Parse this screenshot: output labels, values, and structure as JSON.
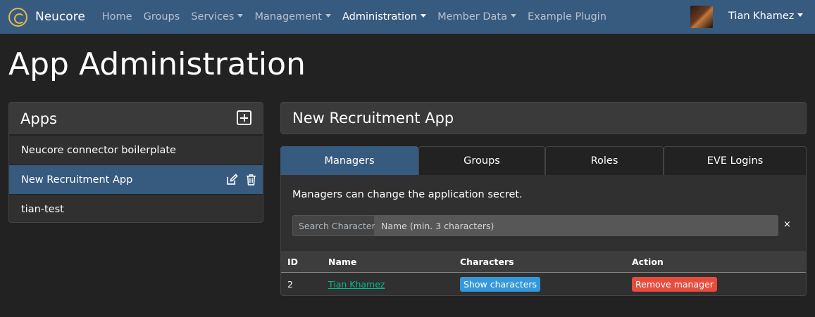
{
  "navbar": {
    "brand": "Neucore",
    "items": [
      {
        "label": "Home",
        "dropdown": false,
        "active": false
      },
      {
        "label": "Groups",
        "dropdown": false,
        "active": false
      },
      {
        "label": "Services",
        "dropdown": true,
        "active": false
      },
      {
        "label": "Management",
        "dropdown": true,
        "active": false
      },
      {
        "label": "Administration",
        "dropdown": true,
        "active": true
      },
      {
        "label": "Member Data",
        "dropdown": true,
        "active": false
      },
      {
        "label": "Example Plugin",
        "dropdown": false,
        "active": false
      }
    ],
    "user_name": "Tian Khamez"
  },
  "page": {
    "title": "App Administration"
  },
  "apps": {
    "header": "Apps",
    "items": [
      {
        "label": "Neucore connector boilerplate",
        "selected": false
      },
      {
        "label": "New Recruitment App",
        "selected": true
      },
      {
        "label": "tian-test",
        "selected": false
      }
    ]
  },
  "detail": {
    "title": "New Recruitment App",
    "tabs": [
      "Managers",
      "Groups",
      "Roles",
      "EVE Logins"
    ],
    "active_tab": "Managers",
    "description": "Managers can change the application secret.",
    "search": {
      "label": "Search Character",
      "placeholder": "Name (min. 3 characters)",
      "clear": "×"
    },
    "table": {
      "headers": {
        "id": "ID",
        "name": "Name",
        "characters": "Characters",
        "action": "Action"
      },
      "rows": [
        {
          "id": "2",
          "name": "Tian Khamez",
          "characters_button": "Show characters",
          "action_button": "Remove manager"
        }
      ]
    }
  },
  "colors": {
    "navbar": "#375a7f",
    "background": "#222222",
    "link": "#00bc8c",
    "info": "#3498db",
    "danger": "#e74c3c"
  }
}
